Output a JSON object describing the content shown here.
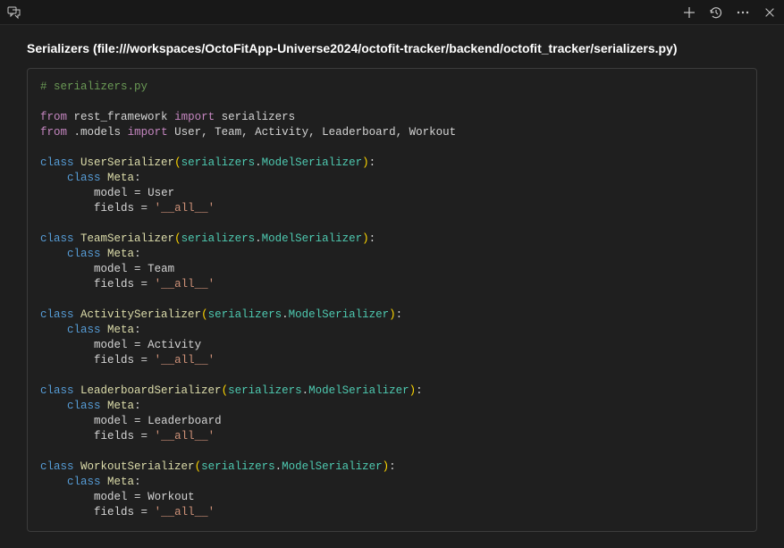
{
  "titlebar": {
    "icons_left": [
      "comment-discussion-icon"
    ],
    "icons_right": [
      "add-icon",
      "history-icon",
      "more-icon",
      "close-icon"
    ]
  },
  "title": "Serializers (file:///workspaces/OctoFitApp-Universe2024/octofit-tracker/backend/octofit_tracker/serializers.py)",
  "code": {
    "comment": "# serializers.py",
    "import1_from": "from",
    "import1_mod": "rest_framework",
    "import1_import": "import",
    "import1_items": "serializers",
    "import2_from": "from",
    "import2_mod": ".models",
    "import2_import": "import",
    "import2_items": "User, Team, Activity, Leaderboard, Workout",
    "kw_class": "class",
    "kw_meta": "Meta",
    "kw_model": "model",
    "kw_fields": "fields",
    "eq": "=",
    "all_str": "'__all__'",
    "serializers_ref": "serializers",
    "modelserializer_ref": "ModelSerializer",
    "classes": [
      {
        "name": "UserSerializer",
        "model": "User"
      },
      {
        "name": "TeamSerializer",
        "model": "Team"
      },
      {
        "name": "ActivitySerializer",
        "model": "Activity"
      },
      {
        "name": "LeaderboardSerializer",
        "model": "Leaderboard"
      },
      {
        "name": "WorkoutSerializer",
        "model": "Workout"
      }
    ]
  }
}
